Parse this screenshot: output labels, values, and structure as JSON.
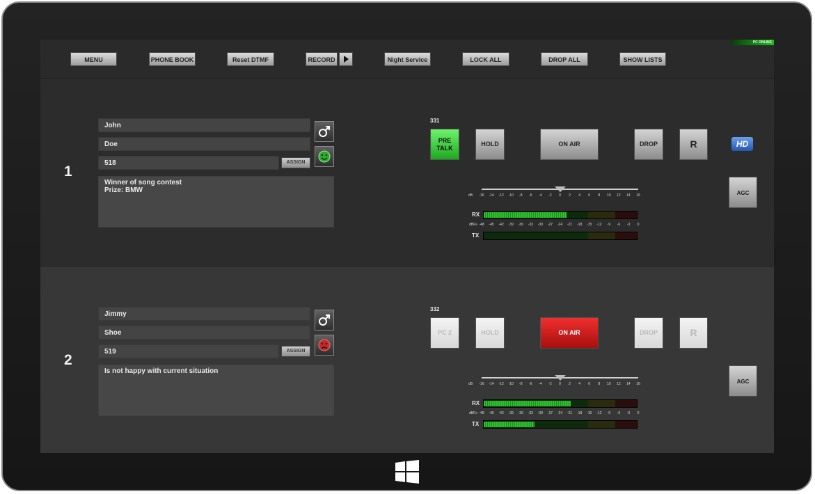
{
  "status": {
    "online": "PC ONLINE"
  },
  "toolbar": {
    "buttons": [
      "MENU",
      "PHONE BOOK",
      "Reset DTMF",
      "RECORD",
      "Night Service",
      "LOCK ALL",
      "DROP ALL",
      "SHOW LISTS"
    ]
  },
  "lines": [
    {
      "number": "1",
      "first_name": "John",
      "last_name": "Doe",
      "caller_id": "518",
      "assign_label": "ASSIGN",
      "notes": "Winner of song contest\nPrize: BMW",
      "gender_icon": "male-icon",
      "mood_icon": "happy-face-icon",
      "mood_color": "#2ea82e",
      "extension": "331",
      "buttons": {
        "talk": "PRE TALK",
        "hold": "HOLD",
        "on_air": "ON AIR",
        "drop": "DROP",
        "r": "R"
      },
      "hd_label": "HD",
      "agc_label": "AGC",
      "meters": {
        "rx_label": "RX",
        "tx_label": "TX",
        "rx_level": 0.54,
        "tx_level": 0.0
      }
    },
    {
      "number": "2",
      "first_name": "Jimmy",
      "last_name": "Shoe",
      "caller_id": "519",
      "assign_label": "ASSIGN",
      "notes": "Is not happy with current situation",
      "gender_icon": "male-icon",
      "mood_icon": "sad-face-icon",
      "mood_color": "#c22b2b",
      "extension": "332",
      "buttons": {
        "talk": "PC 2",
        "hold": "HOLD",
        "on_air": "ON AIR",
        "drop": "DROP",
        "r": "R"
      },
      "agc_label": "AGC",
      "meters": {
        "rx_label": "RX",
        "tx_label": "TX",
        "rx_level": 0.57,
        "tx_level": 0.33
      }
    }
  ],
  "scales": {
    "db_label": "dB",
    "db_ticks": [
      "-16",
      "-14",
      "-12",
      "-10",
      "-8",
      "-6",
      "-4",
      "-2",
      "0",
      "2",
      "4",
      "6",
      "8",
      "10",
      "12",
      "14",
      "16"
    ],
    "gain_value": 0,
    "dbfs_label": "dBFs",
    "dbfs_ticks": [
      "-48",
      "-45",
      "-42",
      "-39",
      "-36",
      "-33",
      "-30",
      "-27",
      "-24",
      "-21",
      "-18",
      "-15",
      "-12",
      "-9",
      "-6",
      "-3",
      "0"
    ]
  }
}
